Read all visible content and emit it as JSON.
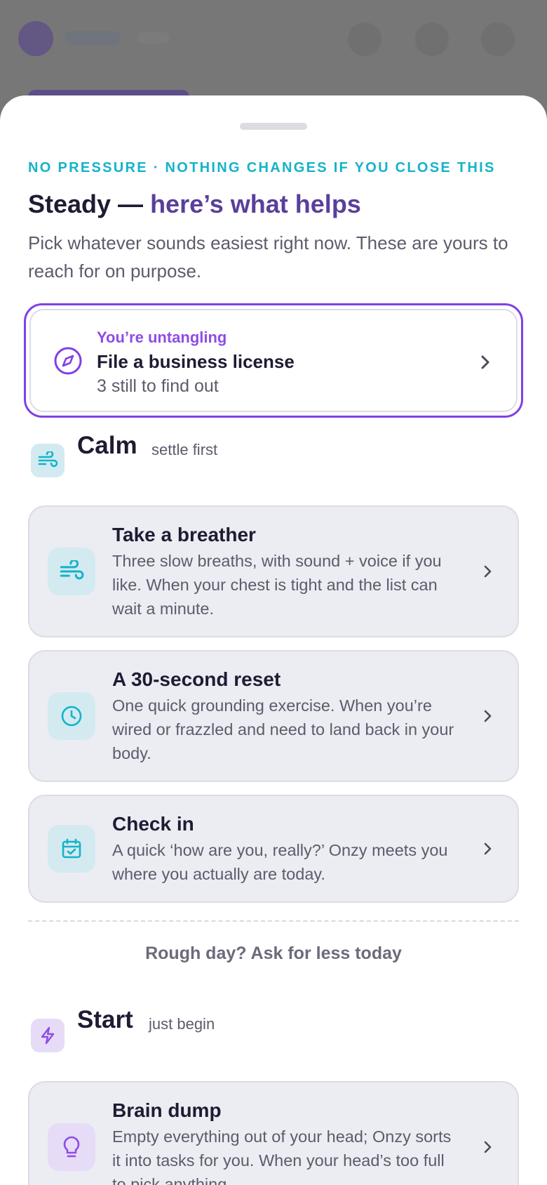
{
  "colors": {
    "accent_teal": "#14b3c9",
    "accent_purple": "#8040e6",
    "title_purple": "#5a3f9c",
    "text_dark": "#1d1c33",
    "text_muted": "#5b5c6c",
    "card_bg": "#ecedf2",
    "calm_icon_bg": "#d3eaf1",
    "start_icon_bg": "#e6dcf7"
  },
  "sheet": {
    "eyebrow": "NO PRESSURE · NOTHING CHANGES IF YOU CLOSE THIS",
    "title_main": "Steady — ",
    "title_accent": "here’s what helps",
    "subtitle": "Pick whatever sounds easiest right now. These are yours to reach for on purpose."
  },
  "untangling": {
    "icon": "compass-icon",
    "label": "You’re untangling",
    "task": "File a business license",
    "subtext": "3 still to find out"
  },
  "sections": {
    "calm": {
      "icon": "wind-icon",
      "title": "Calm",
      "tagline": "settle first",
      "options": [
        {
          "icon": "wind-icon",
          "title": "Take a breather",
          "description": "Three slow breaths, with sound + voice if you like. When your chest is tight and the list can wait a minute."
        },
        {
          "icon": "clock-icon",
          "title": "A 30-second reset",
          "description": "One quick grounding exercise. When you’re wired or frazzled and need to land back in your body."
        },
        {
          "icon": "calendar-check-icon",
          "title": "Check in",
          "description": "A quick ‘how are you, really?’ Onzy meets you where you actually are today."
        }
      ]
    },
    "rough_day_link": "Rough day? Ask for less today",
    "start": {
      "icon": "lightning-icon",
      "title": "Start",
      "tagline": "just begin",
      "options": [
        {
          "icon": "lightbulb-icon",
          "title": "Brain dump",
          "description": "Empty everything out of your head; Onzy sorts it into tasks for you. When your head’s too full to pick anything."
        }
      ]
    }
  }
}
